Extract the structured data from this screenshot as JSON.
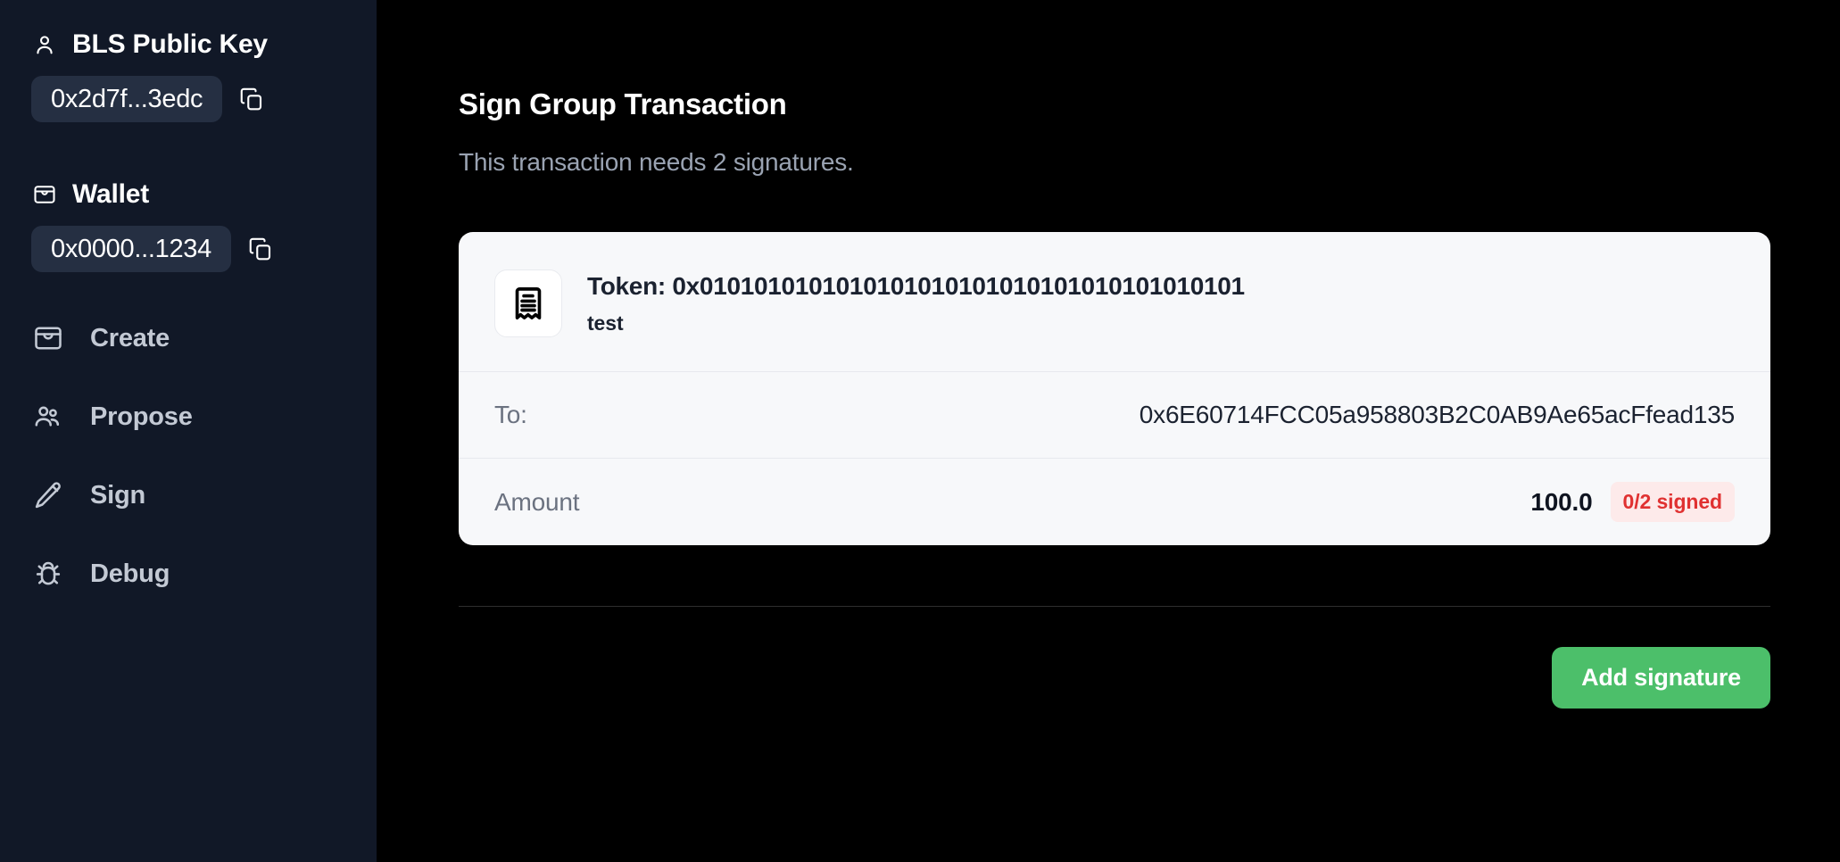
{
  "sidebar": {
    "bls": {
      "heading": "BLS Public Key",
      "address": "0x2d7f...3edc",
      "copy_title": "Copy"
    },
    "wallet": {
      "heading": "Wallet",
      "address": "0x0000...1234",
      "copy_title": "Copy"
    },
    "nav": [
      {
        "label": "Create",
        "icon": "inbox-icon"
      },
      {
        "label": "Propose",
        "icon": "users-icon"
      },
      {
        "label": "Sign",
        "icon": "pencil-icon"
      },
      {
        "label": "Debug",
        "icon": "bug-icon"
      }
    ]
  },
  "main": {
    "title": "Sign Group Transaction",
    "subtitle": "This transaction needs 2 signatures.",
    "card": {
      "token_label": "Token: 0x0101010101010101010101010101010101010101",
      "token_sub": "test",
      "rows": [
        {
          "label": "To:",
          "value": "0x6E60714FCC05a958803B2C0AB9Ae65acFfead135"
        },
        {
          "label": "Amount",
          "value": "100.0"
        }
      ],
      "signature_badge": "0/2 signed"
    },
    "primary_button": "Add signature"
  },
  "colors": {
    "sidebar_bg": "#111827",
    "main_bg": "#000000",
    "card_bg": "#f7f8fa",
    "accent_green": "#4cbf6a",
    "badge_red_text": "#e03131",
    "badge_red_bg": "#fdeaea"
  }
}
